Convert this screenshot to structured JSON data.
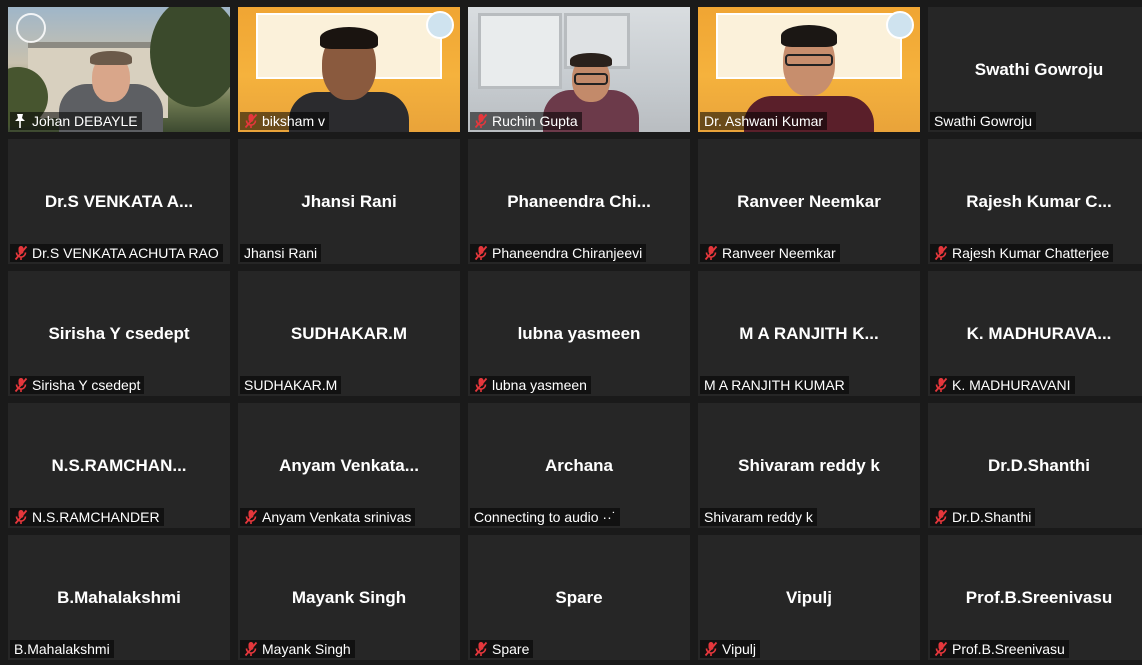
{
  "colors": {
    "background": "#1a1a1a",
    "tile": "#262626",
    "active_speaker_border": "#c7e06a",
    "muted_icon": "#e5373c"
  },
  "participants": [
    {
      "center_name": "",
      "label": "Johan DEBAYLE",
      "muted": false,
      "pinned_icon": true,
      "video": "outdoor",
      "active": true
    },
    {
      "center_name": "",
      "label": "biksham v",
      "muted": true,
      "video": "banner"
    },
    {
      "center_name": "",
      "label": "Ruchin Gupta",
      "muted": true,
      "video": "office"
    },
    {
      "center_name": "",
      "label": "Dr. Ashwani Kumar",
      "muted": false,
      "video": "banner2"
    },
    {
      "center_name": "Swathi Gowroju",
      "label": "Swathi Gowroju",
      "muted": false
    },
    {
      "center_name": "Dr.S VENKATA A...",
      "label": "Dr.S VENKATA ACHUTA RAO",
      "muted": true
    },
    {
      "center_name": "Jhansi Rani",
      "label": "Jhansi Rani",
      "muted": false
    },
    {
      "center_name": "Phaneendra  Chi...",
      "label": "Phaneendra Chiranjeevi",
      "muted": true
    },
    {
      "center_name": "Ranveer Neemkar",
      "label": "Ranveer Neemkar",
      "muted": true
    },
    {
      "center_name": "Rajesh Kumar C...",
      "label": "Rajesh Kumar Chatterjee",
      "muted": true
    },
    {
      "center_name": "Sirisha Y csedept",
      "label": "Sirisha Y csedept",
      "muted": true
    },
    {
      "center_name": "SUDHAKAR.M",
      "label": "SUDHAKAR.M",
      "muted": false
    },
    {
      "center_name": "lubna yasmeen",
      "label": "lubna yasmeen",
      "muted": true
    },
    {
      "center_name": "M A RANJITH K...",
      "label": "M A RANJITH KUMAR",
      "muted": false
    },
    {
      "center_name": "K.  MADHURAVA...",
      "label": "K. MADHURAVANI",
      "muted": true
    },
    {
      "center_name": "N.S.RAMCHAN...",
      "label": "N.S.RAMCHANDER",
      "muted": true
    },
    {
      "center_name": "Anyam  Venkata...",
      "label": "Anyam Venkata srinivas",
      "muted": true
    },
    {
      "center_name": "Archana",
      "label": "Connecting to audio ··˙",
      "muted": false
    },
    {
      "center_name": "Shivaram reddy k",
      "label": "Shivaram reddy k",
      "muted": false
    },
    {
      "center_name": "Dr.D.Shanthi",
      "label": "Dr.D.Shanthi",
      "muted": true
    },
    {
      "center_name": "B.Mahalakshmi",
      "label": "B.Mahalakshmi",
      "muted": false
    },
    {
      "center_name": "Mayank Singh",
      "label": "Mayank Singh",
      "muted": true
    },
    {
      "center_name": "Spare",
      "label": "Spare",
      "muted": true
    },
    {
      "center_name": "Vipulj",
      "label": "Vipulj",
      "muted": true
    },
    {
      "center_name": "Prof.B.Sreenivasu",
      "label": "Prof.B.Sreenivasu",
      "muted": true
    }
  ]
}
